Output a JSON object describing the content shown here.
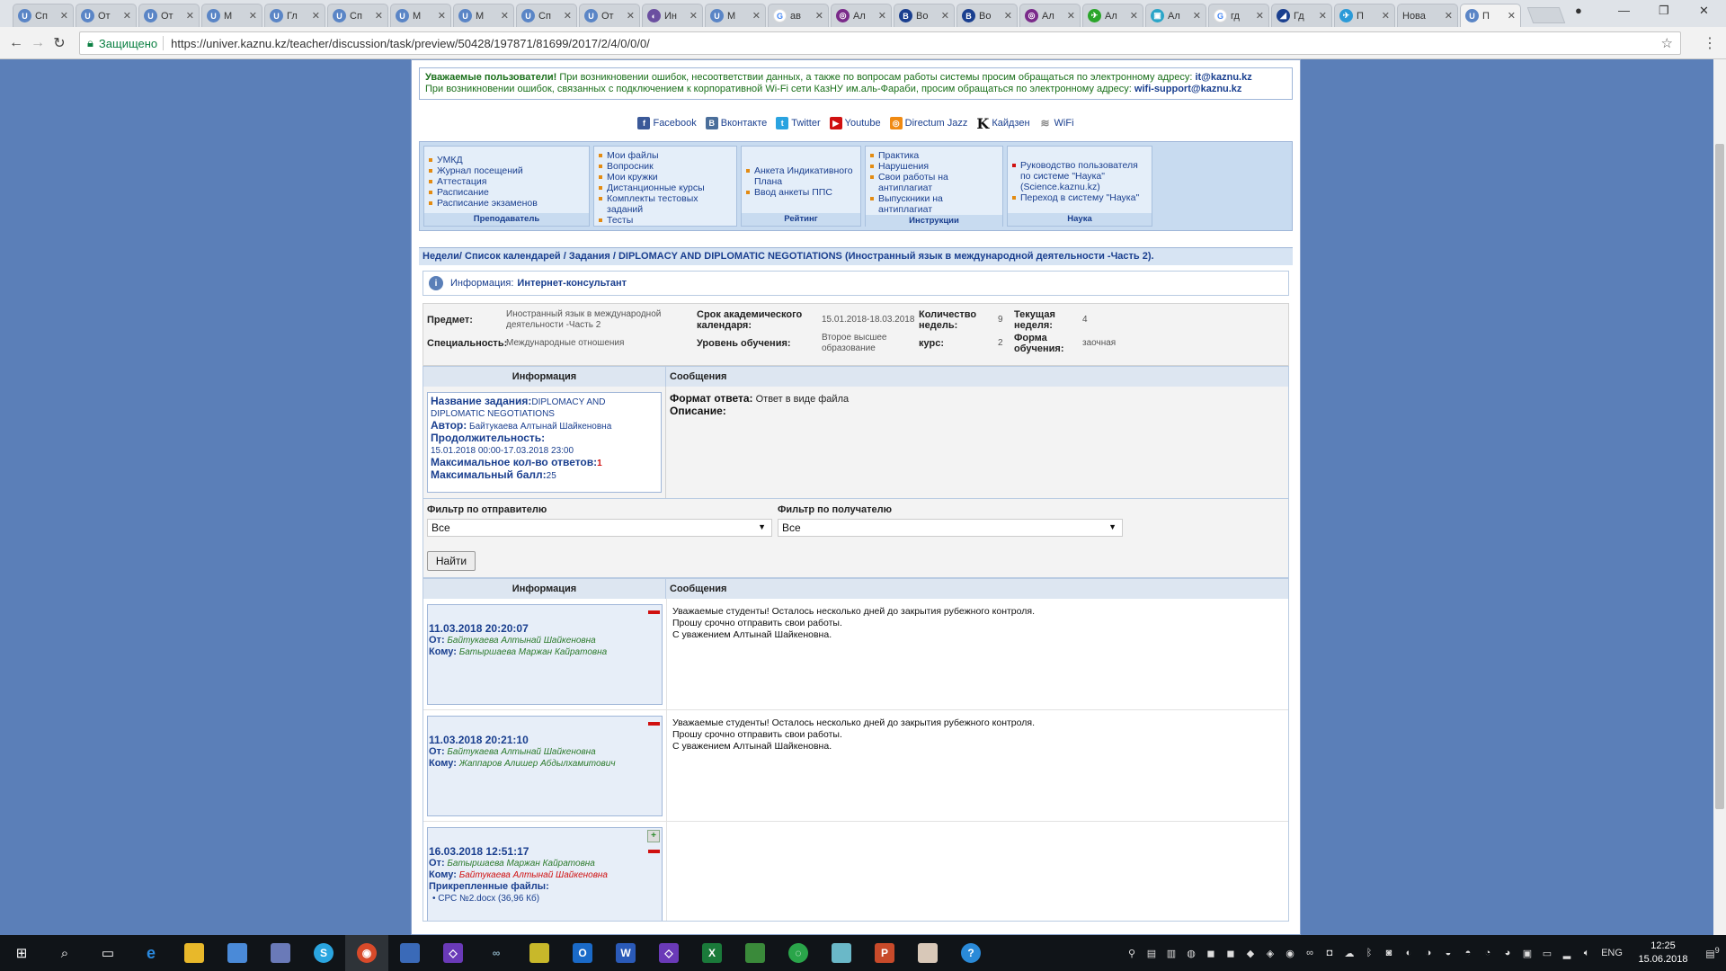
{
  "browser": {
    "tabs": [
      {
        "icon": "U",
        "title": "Сп",
        "color": "#5a85c6"
      },
      {
        "icon": "U",
        "title": "От",
        "color": "#5a85c6"
      },
      {
        "icon": "U",
        "title": "От",
        "color": "#5a85c6"
      },
      {
        "icon": "U",
        "title": "М",
        "color": "#5a85c6"
      },
      {
        "icon": "U",
        "title": "Гл",
        "color": "#5a85c6"
      },
      {
        "icon": "U",
        "title": "Сп",
        "color": "#5a85c6"
      },
      {
        "icon": "U",
        "title": "М",
        "color": "#5a85c6"
      },
      {
        "icon": "U",
        "title": "М",
        "color": "#5a85c6"
      },
      {
        "icon": "U",
        "title": "Сп",
        "color": "#5a85c6"
      },
      {
        "icon": "U",
        "title": "От",
        "color": "#5a85c6"
      },
      {
        "icon": "◐",
        "title": "Ин",
        "color": "#6b4fa0"
      },
      {
        "icon": "U",
        "title": "М",
        "color": "#5a85c6"
      },
      {
        "icon": "G",
        "title": "ав",
        "color": "#ffffff"
      },
      {
        "icon": "◎",
        "title": "Ал",
        "color": "#7a2a8a"
      },
      {
        "icon": "B",
        "title": "Во",
        "color": "#1a3f8f"
      },
      {
        "icon": "B",
        "title": "Во",
        "color": "#1a3f8f"
      },
      {
        "icon": "◎",
        "title": "Ал",
        "color": "#7a2a8a"
      },
      {
        "icon": "✈",
        "title": "Ал",
        "color": "#2aa52a"
      },
      {
        "icon": "▣",
        "title": "Ал",
        "color": "#2aa5c8"
      },
      {
        "icon": "G",
        "title": "гд",
        "color": "#ffffff"
      },
      {
        "icon": "◢",
        "title": "Гд",
        "color": "#1a3f8f"
      },
      {
        "icon": "✈",
        "title": "П",
        "color": "#2a9ad8"
      },
      {
        "icon": "",
        "title": "Нова",
        "color": "#cfd4da"
      },
      {
        "icon": "U",
        "title": "П",
        "color": "#5a85c6",
        "active": true
      }
    ],
    "secure_label": "Защищено",
    "url": "https://univer.kaznu.kz/teacher/discussion/task/preview/50428/197871/81699/2017/2/4/0/0/0/"
  },
  "notice": {
    "line1_bold": "Уважаемые пользователи!",
    "line1": " При возникновении ошибок, несоответствии данных, а также по вопросам работы системы просим обращаться по электронному адресу:",
    "line1_mail": "it@kaznu.kz",
    "line2": "При возникновении ошибок, связанных с подключением к корпоративной Wi-Fi сети КазНУ им.аль-Фараби, просим обращаться по электронному адресу:",
    "line2_mail": "wifi-support@kaznu.kz"
  },
  "social": [
    {
      "label": "Facebook",
      "icon": "f",
      "color": "#3b5998"
    },
    {
      "label": "Вконтакте",
      "icon": "B",
      "color": "#4a6e9a"
    },
    {
      "label": "Twitter",
      "icon": "t",
      "color": "#2aa3e0"
    },
    {
      "label": "Youtube",
      "icon": "▶",
      "color": "#d01010"
    },
    {
      "label": "Directum Jazz",
      "icon": "◎",
      "color": "#f08a12"
    },
    {
      "label": "Кайдзен",
      "icon": "K",
      "color": "#111111"
    },
    {
      "label": "WiFi",
      "icon": "≋",
      "color": "#888888"
    }
  ],
  "menu": [
    {
      "caption": "Преподаватель",
      "items": [
        "УМКД",
        "Журнал посещений",
        "Аттестация",
        "Расписание",
        "Расписание экзаменов"
      ]
    },
    {
      "caption": "",
      "items": [
        "Мои файлы",
        "Вопросник",
        "Мои кружки",
        "Дистанционные курсы",
        "Комплекты тестовых заданий",
        "Тесты"
      ]
    },
    {
      "caption": "Рейтинг",
      "items": [
        "Анкета Индикативного Плана",
        "Ввод анкеты ППС"
      ]
    },
    {
      "caption": "Инструкции",
      "items": [
        "Практика",
        "Нарушения",
        "Свои работы на антиплагиат",
        "Выпускники на антиплагиат"
      ]
    },
    {
      "caption": "Наука",
      "items": [
        "Руководство пользователя по системе \"Наука\" (Science.kaznu.kz)",
        "Переход в систему \"Наука\""
      ]
    }
  ],
  "breadcrumb": "Недели/ Список календарей / Задания / DIPLOMACY AND DIPLOMATIC NEGOTIATIONS (Иностранный язык в международной деятельности -Часть 2).",
  "info": {
    "label": "Информация:",
    "value": "Интернет-консультант"
  },
  "meta": {
    "subject_k": "Предмет:",
    "subject_v": "Иностранный язык в международной деятельности -Часть 2",
    "spec_k": "Специальность:",
    "spec_v": "Международные отношения",
    "period_k": "Срок академического календаря:",
    "period_v": "15.01.2018-18.03.2018",
    "level_k": "Уровень обучения:",
    "level_v": "Второе высшее образование",
    "weeks_k": "Количество недель:",
    "weeks_v": "9",
    "course_k": "курс:",
    "course_v": "2",
    "cur_k": "Текущая неделя:",
    "cur_v": "4",
    "form_k": "Форма обучения:",
    "form_v": "заочная"
  },
  "task": {
    "col_info": "Информация",
    "col_msgs": "Сообщения",
    "name_k": "Название задания:",
    "name_v": "DIPLOMACY AND DIPLOMATIC NEGOTIATIONS",
    "author_k": "Автор:",
    "author_v": "Байтукаева Алтынай Шайкеновна",
    "dur_k": "Продолжительность:",
    "dur_v": "15.01.2018 00:00-17.03.2018 23:00",
    "maxans_k": "Максимальное кол-во ответов:",
    "maxans_v": "1",
    "maxscore_k": "Максимальный балл:",
    "maxscore_v": "25",
    "format_k": "Формат ответа:",
    "format_v": "Ответ в виде файла",
    "desc_k": "Описание:"
  },
  "filters": {
    "sender_label": "Фильтр по отправителю",
    "sender_value": "Все",
    "receiver_label": "Фильтр по получателю",
    "receiver_value": "Все",
    "find_label": "Найти"
  },
  "messages_header": {
    "col_info": "Информация",
    "col_msgs": "Сообщения"
  },
  "messages": [
    {
      "date": "11.03.2018 20:20:07",
      "from_k": "От:",
      "from": "Байтукаева Алтынай Шайкеновна",
      "to_k": "Кому:",
      "to": "Батыршаева Маржан Кайратовна",
      "text": [
        "Уважаемые студенты! Осталось несколько дней до закрытия рубежного контроля.",
        "Прошу срочно отправить свои работы.",
        "С уважением Алтынай Шайкеновна."
      ]
    },
    {
      "date": "11.03.2018 20:21:10",
      "from_k": "От:",
      "from": "Байтукаева Алтынай Шайкеновна",
      "to_k": "Кому:",
      "to": "Жаппаров Алишер Абдылхамитович",
      "text": [
        "Уважаемые студенты! Осталось несколько дней до закрытия рубежного контроля.",
        "Прошу срочно отправить свои работы.",
        "С уважением Алтынай Шайкеновна."
      ]
    },
    {
      "date": "16.03.2018 12:51:17",
      "from_k": "От:",
      "from": "Батыршаева Маржан Кайратовна",
      "to_k": "Кому:",
      "to": "Байтукаева Алтынай Шайкеновна",
      "files_k": "Прикрепленные файлы:",
      "file": "СРС №2.docx (36,96 Кб)",
      "text": []
    }
  ],
  "taskbar": {
    "lang": "ENG",
    "time": "12:25",
    "date": "15.06.2018",
    "notif": "9"
  }
}
